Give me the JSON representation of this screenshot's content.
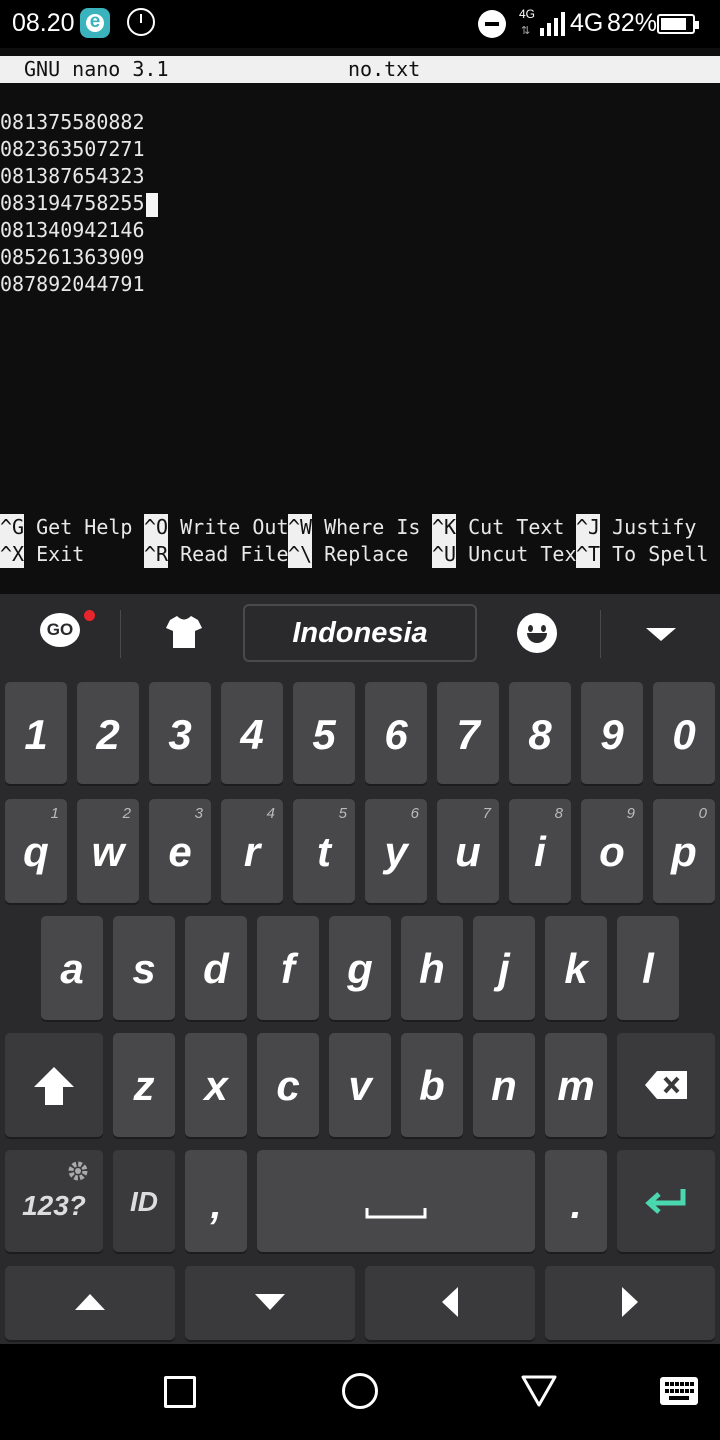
{
  "status_bar": {
    "time": "08.20",
    "eset_letter": "e",
    "network_small": "4G",
    "network": "4G",
    "battery_percent": "82%",
    "battery_level": 0.82
  },
  "nano": {
    "version": "GNU nano 3.1",
    "filename": "no.txt",
    "lines": [
      "081375580882",
      "082363507271",
      "081387654323",
      "083194758255",
      "081340942146",
      "085261363909",
      "087892044791"
    ],
    "cursor_line": 4,
    "shortcuts_row1": [
      {
        "key": "^G",
        "label": "Get Help"
      },
      {
        "key": "^O",
        "label": "Write Out"
      },
      {
        "key": "^W",
        "label": "Where Is"
      },
      {
        "key": "^K",
        "label": "Cut Text"
      },
      {
        "key": "^J",
        "label": "Justify"
      }
    ],
    "shortcuts_row2": [
      {
        "key": "^X",
        "label": "Exit"
      },
      {
        "key": "^R",
        "label": "Read File"
      },
      {
        "key": "^\\",
        "label": "Replace"
      },
      {
        "key": "^U",
        "label": "Uncut Tex"
      },
      {
        "key": "^T",
        "label": "To Spell"
      }
    ]
  },
  "keyboard": {
    "go_label": "GO",
    "language": "Indonesia",
    "number_row": [
      "1",
      "2",
      "3",
      "4",
      "5",
      "6",
      "7",
      "8",
      "9",
      "0"
    ],
    "row_q": [
      {
        "letter": "q",
        "hint": "1"
      },
      {
        "letter": "w",
        "hint": "2"
      },
      {
        "letter": "e",
        "hint": "3"
      },
      {
        "letter": "r",
        "hint": "4"
      },
      {
        "letter": "t",
        "hint": "5"
      },
      {
        "letter": "y",
        "hint": "6"
      },
      {
        "letter": "u",
        "hint": "7"
      },
      {
        "letter": "i",
        "hint": "8"
      },
      {
        "letter": "o",
        "hint": "9"
      },
      {
        "letter": "p",
        "hint": "0"
      }
    ],
    "row_a": [
      "a",
      "s",
      "d",
      "f",
      "g",
      "h",
      "j",
      "k",
      "l"
    ],
    "row_z": [
      "z",
      "x",
      "c",
      "v",
      "b",
      "n",
      "m"
    ],
    "symbols_label": "123?",
    "lang_key": "ID",
    "comma": ",",
    "period": ".",
    "enter_color": "#4ad8b0"
  },
  "colors": {
    "terminal_bg": "#0e0e0e",
    "keyboard_bg": "#2a2a2c",
    "key_bg": "#48484a"
  }
}
